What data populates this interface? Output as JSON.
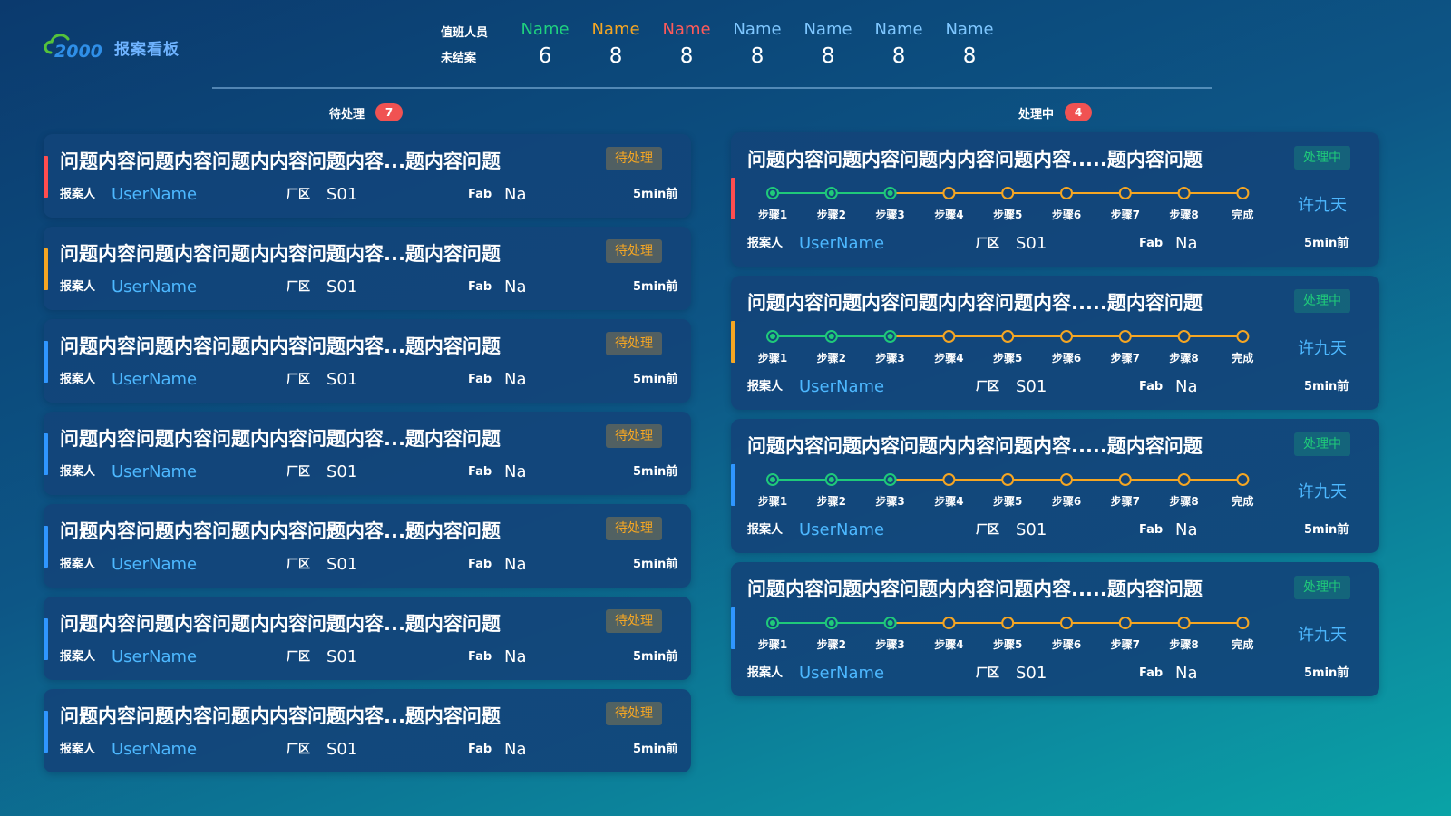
{
  "app": {
    "logo_number": "2000",
    "logo_title": "报案看板",
    "brand_color": "#2f8fe8",
    "logo_accent": "#55c23b"
  },
  "duty": {
    "label_staff": "值班人员",
    "label_open": "未结案",
    "people": [
      {
        "name": "Name",
        "count": "6",
        "color": "#1fd17f"
      },
      {
        "name": "Name",
        "count": "8",
        "color": "#f5a623"
      },
      {
        "name": "Name",
        "count": "8",
        "color": "#ff5a5a"
      },
      {
        "name": "Name",
        "count": "8",
        "color": "#7fc7ff"
      },
      {
        "name": "Name",
        "count": "8",
        "color": "#7fc7ff"
      },
      {
        "name": "Name",
        "count": "8",
        "color": "#7fc7ff"
      },
      {
        "name": "Name",
        "count": "8",
        "color": "#7fc7ff"
      }
    ]
  },
  "pending": {
    "title": "待处理",
    "count": "7",
    "cards": [
      {
        "title": "问题内容问题内容问题内内容问题内容...题内容问题",
        "status": "待处理",
        "reporter_label": "报案人",
        "reporter": "UserName",
        "area_label": "厂区",
        "area": "S01",
        "fab_label": "Fab",
        "fab": "Na",
        "time": "5min前",
        "stripe_color": "#ff4d4f"
      },
      {
        "title": "问题内容问题内容问题内内容问题内容...题内容问题",
        "status": "待处理",
        "reporter_label": "报案人",
        "reporter": "UserName",
        "area_label": "厂区",
        "area": "S01",
        "fab_label": "Fab",
        "fab": "Na",
        "time": "5min前",
        "stripe_color": "#f5a623"
      },
      {
        "title": "问题内容问题内容问题内内容问题内容...题内容问题",
        "status": "待处理",
        "reporter_label": "报案人",
        "reporter": "UserName",
        "area_label": "厂区",
        "area": "S01",
        "fab_label": "Fab",
        "fab": "Na",
        "time": "5min前",
        "stripe_color": "#2f96ff"
      },
      {
        "title": "问题内容问题内容问题内内容问题内容...题内容问题",
        "status": "待处理",
        "reporter_label": "报案人",
        "reporter": "UserName",
        "area_label": "厂区",
        "area": "S01",
        "fab_label": "Fab",
        "fab": "Na",
        "time": "5min前",
        "stripe_color": "#2f96ff"
      },
      {
        "title": "问题内容问题内容问题内内容问题内容...题内容问题",
        "status": "待处理",
        "reporter_label": "报案人",
        "reporter": "UserName",
        "area_label": "厂区",
        "area": "S01",
        "fab_label": "Fab",
        "fab": "Na",
        "time": "5min前",
        "stripe_color": "#2f96ff"
      },
      {
        "title": "问题内容问题内容问题内内容问题内容...题内容问题",
        "status": "待处理",
        "reporter_label": "报案人",
        "reporter": "UserName",
        "area_label": "厂区",
        "area": "S01",
        "fab_label": "Fab",
        "fab": "Na",
        "time": "5min前",
        "stripe_color": "#2f96ff"
      },
      {
        "title": "问题内容问题内容问题内内容问题内容...题内容问题",
        "status": "待处理",
        "reporter_label": "报案人",
        "reporter": "UserName",
        "area_label": "厂区",
        "area": "S01",
        "fab_label": "Fab",
        "fab": "Na",
        "time": "5min前",
        "stripe_color": "#2f96ff"
      }
    ]
  },
  "processing": {
    "title": "处理中",
    "count": "4",
    "completed_color": "#1fc97a",
    "remaining_color": "#f5a623",
    "cards": [
      {
        "title": "问题内容问题内容问题内内容问题内容.....题内容问题",
        "status": "处理中",
        "assignee": "许九天",
        "steps": [
          "步骤1",
          "步骤2",
          "步骤3",
          "步骤4",
          "步骤5",
          "步骤6",
          "步骤7",
          "步骤8",
          "完成"
        ],
        "completed_steps": 3,
        "reporter_label": "报案人",
        "reporter": "UserName",
        "area_label": "厂区",
        "area": "S01",
        "fab_label": "Fab",
        "fab": "Na",
        "time": "5min前",
        "stripe_color": "#ff4d4f"
      },
      {
        "title": "问题内容问题内容问题内内容问题内容.....题内容问题",
        "status": "处理中",
        "assignee": "许九天",
        "steps": [
          "步骤1",
          "步骤2",
          "步骤3",
          "步骤4",
          "步骤5",
          "步骤6",
          "步骤7",
          "步骤8",
          "完成"
        ],
        "completed_steps": 3,
        "reporter_label": "报案人",
        "reporter": "UserName",
        "area_label": "厂区",
        "area": "S01",
        "fab_label": "Fab",
        "fab": "Na",
        "time": "5min前",
        "stripe_color": "#f5a623"
      },
      {
        "title": "问题内容问题内容问题内内容问题内容.....题内容问题",
        "status": "处理中",
        "assignee": "许九天",
        "steps": [
          "步骤1",
          "步骤2",
          "步骤3",
          "步骤4",
          "步骤5",
          "步骤6",
          "步骤7",
          "步骤8",
          "完成"
        ],
        "completed_steps": 3,
        "reporter_label": "报案人",
        "reporter": "UserName",
        "area_label": "厂区",
        "area": "S01",
        "fab_label": "Fab",
        "fab": "Na",
        "time": "5min前",
        "stripe_color": "#2f96ff"
      },
      {
        "title": "问题内容问题内容问题内内容问题内容.....题内容问题",
        "status": "处理中",
        "assignee": "许九天",
        "steps": [
          "步骤1",
          "步骤2",
          "步骤3",
          "步骤4",
          "步骤5",
          "步骤6",
          "步骤7",
          "步骤8",
          "完成"
        ],
        "completed_steps": 3,
        "reporter_label": "报案人",
        "reporter": "UserName",
        "area_label": "厂区",
        "area": "S01",
        "fab_label": "Fab",
        "fab": "Na",
        "time": "5min前",
        "stripe_color": "#2f96ff"
      }
    ]
  }
}
